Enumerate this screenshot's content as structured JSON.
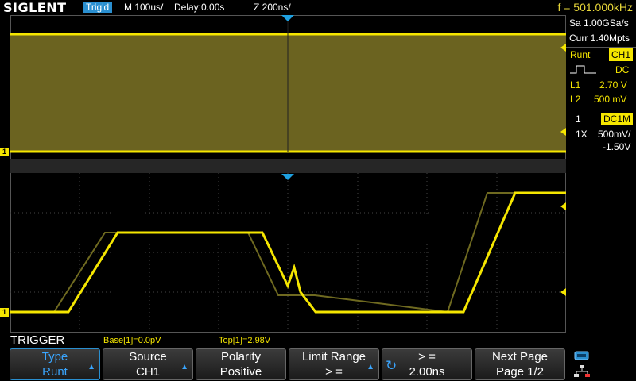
{
  "header": {
    "brand": "SIGLENT",
    "status": "Trig'd",
    "timebase": "M 100us/",
    "delay": "Delay:0.00s",
    "zoom": "Z 200ns/",
    "frequency": "f = 501.000kHz"
  },
  "side_panel": {
    "sample_rate": "Sa 1.00GSa/s",
    "memory": "Curr 1.40Mpts",
    "trigger_type": "Runt",
    "trigger_source": "CH1",
    "coupling": "DC",
    "l1_label": "L1",
    "l1_value": "2.70 V",
    "l2_label": "L2",
    "l2_value": "500 mV",
    "channel_number": "1",
    "channel_coupling": "DC1M",
    "probe": "1X",
    "volts_div": "500mV/",
    "offset": "-1.50V"
  },
  "markers": {
    "ch1": "1"
  },
  "measurements": {
    "trigger_title": "TRIGGER",
    "base": "Base[1]=0.0pV",
    "top": "Top[1]=2.98V"
  },
  "softkeys": [
    {
      "line1": "Type",
      "line2": "Runt"
    },
    {
      "line1": "Source",
      "line2": "CH1"
    },
    {
      "line1": "Polarity",
      "line2": "Positive"
    },
    {
      "line1": "Limit Range",
      "line2": "> ="
    },
    {
      "line1": "> =",
      "line2": "2.00ns"
    },
    {
      "line1": "Next Page",
      "line2": "Page 1/2"
    }
  ],
  "colors": {
    "trace": "#f5e600",
    "accent": "#2a8fd0"
  }
}
